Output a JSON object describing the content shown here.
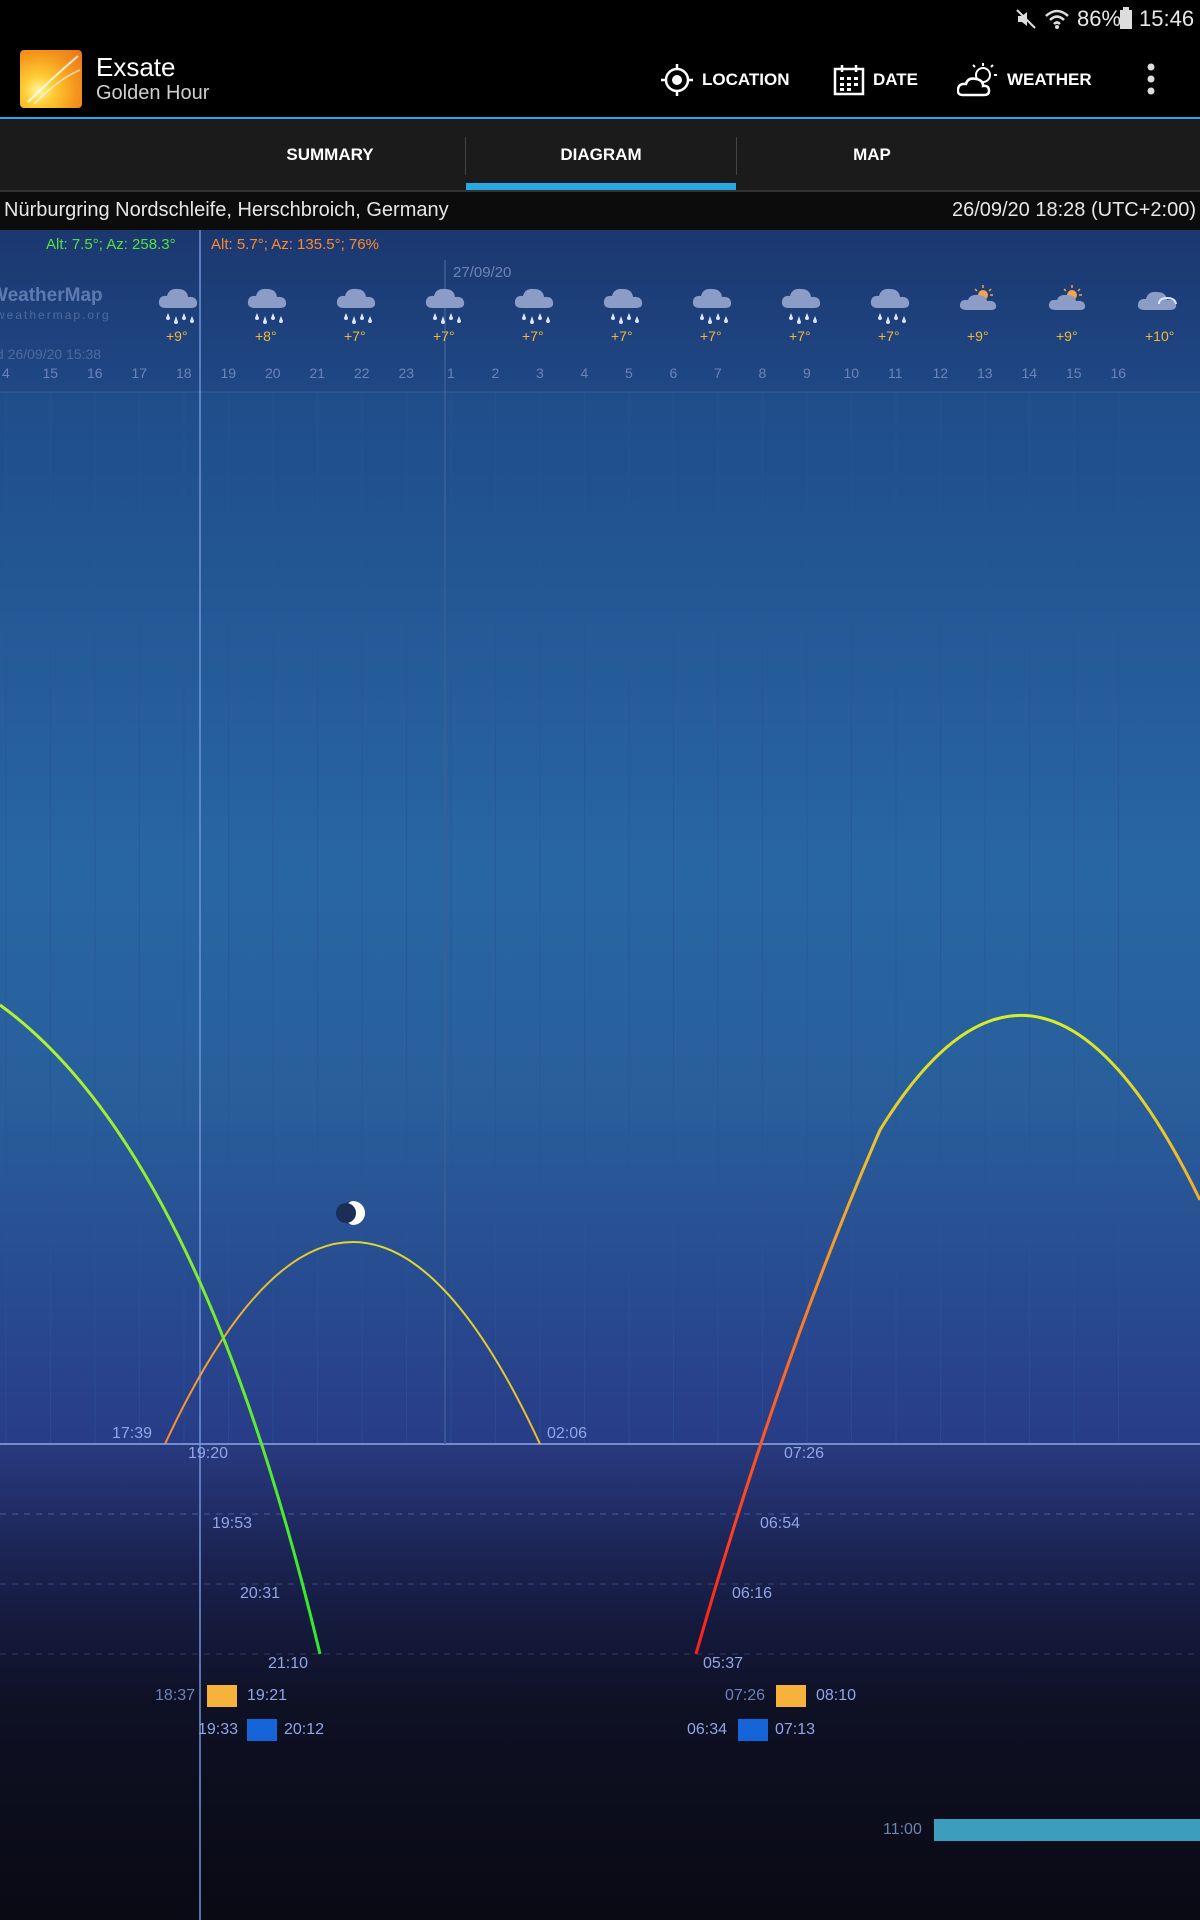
{
  "status": {
    "battery": "86%",
    "time": "15:46"
  },
  "app": {
    "title": "Exsate",
    "subtitle": "Golden Hour"
  },
  "actions": {
    "location": "LOCATION",
    "date": "DATE",
    "weather": "WEATHER"
  },
  "tabs": [
    "SUMMARY",
    "DIAGRAM",
    "MAP"
  ],
  "location": {
    "place": "Nürburgring Nordschleife, Herschbroich, Germany",
    "datetime": "26/09/20 18:28 (UTC+2:00)"
  },
  "diagram": {
    "sun_readout": "Alt: 7.5°; Az: 258.3°",
    "moon_readout": "Alt: 5.7°; Az: 135.5°; 76%",
    "next_day_label": "27/09/20",
    "watermark": "WeatherMap",
    "watermark_sub": "weathermap.org",
    "forecast_time": "d 26/09/20 15:38",
    "hours": [
      "4",
      "15",
      "16",
      "17",
      "18",
      "19",
      "20",
      "21",
      "22",
      "23",
      "1",
      "2",
      "3",
      "4",
      "5",
      "6",
      "7",
      "8",
      "9",
      "10",
      "11",
      "12",
      "13",
      "14",
      "15",
      "16"
    ],
    "forecast": [
      {
        "icon": "rain-cloud-icon",
        "temp": "+9°"
      },
      {
        "icon": "rain-cloud-icon",
        "temp": "+8°"
      },
      {
        "icon": "rain-cloud-icon",
        "temp": "+7°"
      },
      {
        "icon": "rain-cloud-icon",
        "temp": "+7°"
      },
      {
        "icon": "rain-cloud-icon",
        "temp": "+7°"
      },
      {
        "icon": "rain-cloud-icon",
        "temp": "+7°"
      },
      {
        "icon": "rain-cloud-icon",
        "temp": "+7°"
      },
      {
        "icon": "rain-cloud-icon",
        "temp": "+7°"
      },
      {
        "icon": "rain-cloud-icon",
        "temp": "+7°"
      },
      {
        "icon": "partly-sunny-icon",
        "temp": "+9°"
      },
      {
        "icon": "partly-sunny-icon",
        "temp": "+9°"
      },
      {
        "icon": "cloud-icon",
        "temp": "+10°"
      }
    ],
    "times": {
      "moonrise": "17:39",
      "moonset": "02:06",
      "sunset": "19:20",
      "civil_dusk": "19:53",
      "nautical_dusk": "20:31",
      "astro_dusk": "21:10",
      "sunrise": "07:26",
      "civil_dawn": "06:54",
      "nautical_dawn": "06:16",
      "astro_dawn": "05:37",
      "golden_eve_start": "18:37",
      "golden_eve_end": "19:21",
      "blue_eve_start": "19:33",
      "blue_eve_end": "20:12",
      "golden_morn_start": "07:26",
      "golden_morn_end": "08:10",
      "blue_morn_start": "06:34",
      "blue_morn_end": "07:13",
      "bar_start": "11:00"
    },
    "colors": {
      "golden": "#f7b23b",
      "blue": "#1565d8",
      "bar": "#3d9dbd",
      "accent": "#2aa8e0"
    }
  }
}
